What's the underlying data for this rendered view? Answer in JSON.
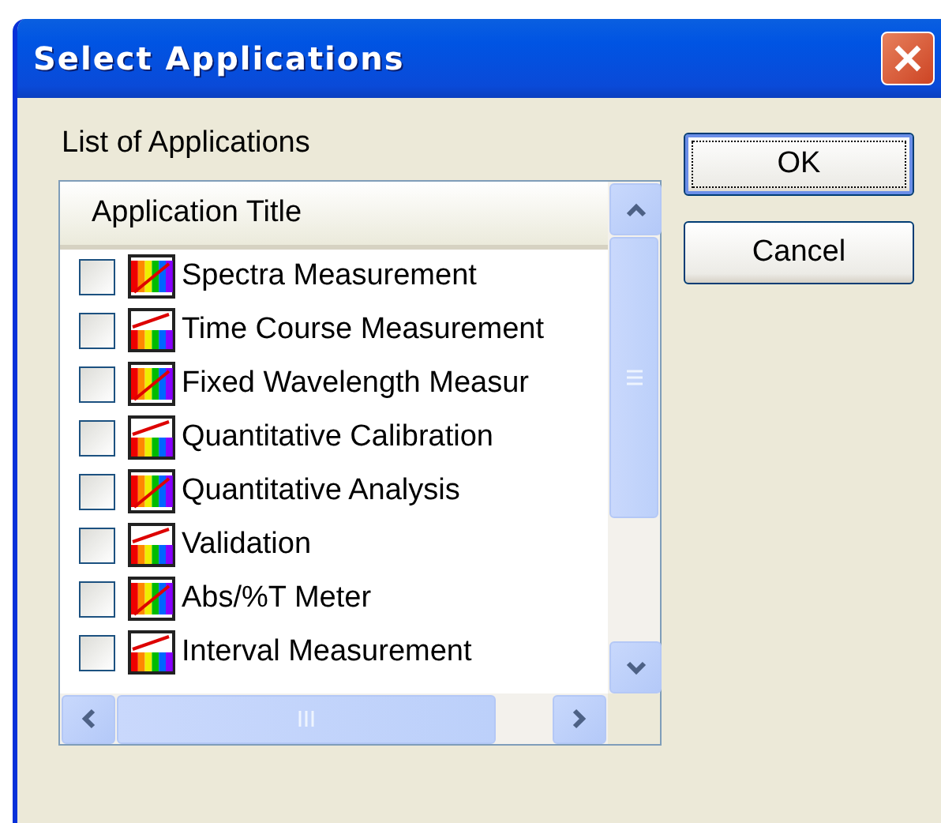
{
  "window": {
    "title": "Select Applications"
  },
  "list_label": "List of Applications",
  "list": {
    "column_header": "Application Title",
    "items": [
      {
        "label": "Spectra Measurement",
        "checked": false
      },
      {
        "label": "Time Course Measurement",
        "checked": false
      },
      {
        "label": "Fixed Wavelength Measur",
        "checked": false
      },
      {
        "label": "Quantitative Calibration",
        "checked": false
      },
      {
        "label": "Quantitative Analysis",
        "checked": false
      },
      {
        "label": "Validation",
        "checked": false
      },
      {
        "label": "Abs/%T Meter",
        "checked": false
      },
      {
        "label": "Interval Measurement",
        "checked": false
      }
    ]
  },
  "buttons": [
    {
      "label": "OK",
      "default": true
    },
    {
      "label": "Cancel",
      "default": false
    }
  ]
}
